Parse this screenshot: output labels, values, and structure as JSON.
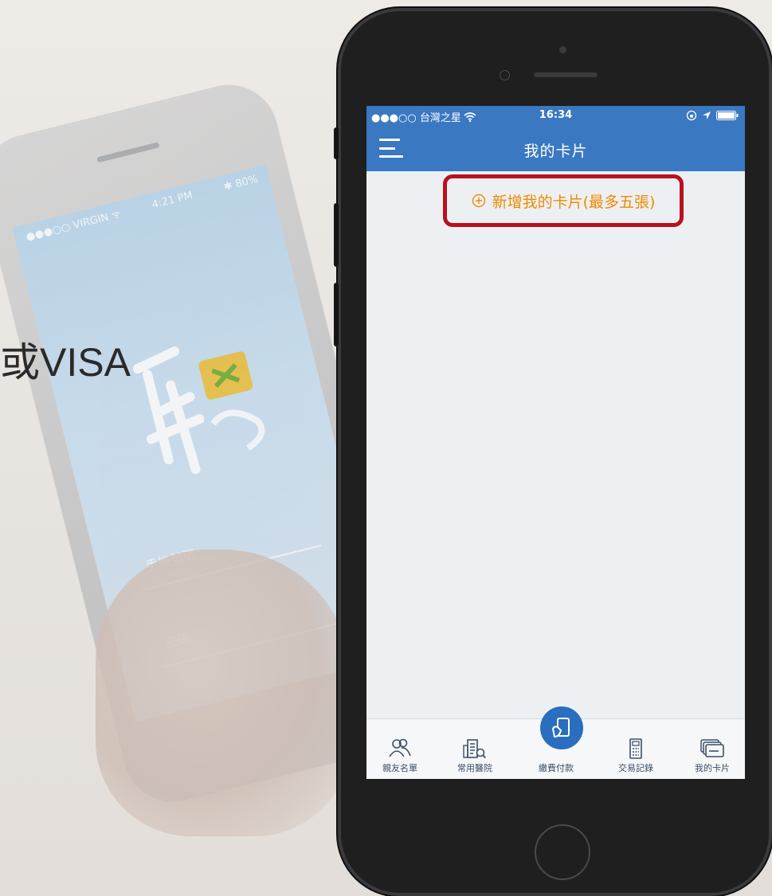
{
  "background": {
    "caption": "或VISA",
    "bg_phone_status": {
      "left": "●●●○○ VIRGIN ᯤ",
      "center": "4:21 PM",
      "right": "✱ 80%"
    },
    "bg_field_label": "手機號碼",
    "bg_field_label2": "密碼"
  },
  "status_bar": {
    "carrier": "●●●○○ 台灣之星",
    "time": "16:34",
    "right_icons": [
      "lock-rotation-icon",
      "location-arrow-icon",
      "battery-icon"
    ]
  },
  "nav": {
    "title": "我的卡片",
    "menu_icon": "hamburger-menu-icon"
  },
  "add_card": {
    "label": "新增我的卡片(最多五張)",
    "icon": "plus-circle-icon",
    "highlight_color": "#b8121f",
    "text_color": "#f08a00"
  },
  "tab_bar": {
    "items": [
      {
        "label": "親友名單",
        "icon": "contacts-icon"
      },
      {
        "label": "常用醫院",
        "icon": "hospital-search-icon"
      },
      {
        "label": "繳費付款",
        "icon": "payment-icon"
      },
      {
        "label": "交易記錄",
        "icon": "receipt-icon"
      },
      {
        "label": "我的卡片",
        "icon": "cards-icon"
      }
    ]
  },
  "colors": {
    "nav_blue": "#3a78c2",
    "screen_bg": "#edf0f2",
    "tab_text": "#3a4f67",
    "center_button": "#2a6ebf"
  }
}
